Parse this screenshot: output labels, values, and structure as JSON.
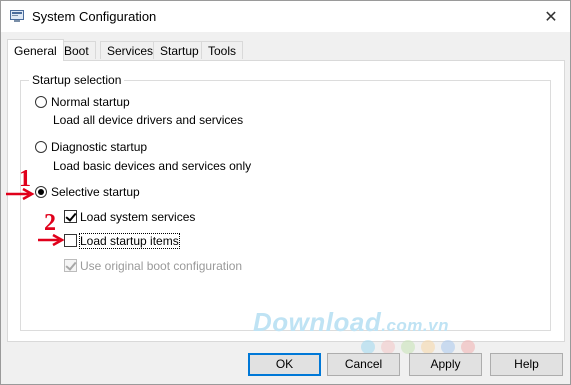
{
  "window": {
    "title": "System Configuration",
    "close_glyph": "✕"
  },
  "tabs": [
    "General",
    "Boot",
    "Services",
    "Startup",
    "Tools"
  ],
  "active_tab": "General",
  "startup_selection": {
    "label": "Startup selection",
    "normal": {
      "label": "Normal startup",
      "description": "Load all device drivers and services",
      "selected": false
    },
    "diagnostic": {
      "label": "Diagnostic startup",
      "description": "Load basic devices and services only",
      "selected": false
    },
    "selective": {
      "label": "Selective startup",
      "selected": true,
      "options": [
        {
          "label": "Load system services",
          "checked": true,
          "enabled": true
        },
        {
          "label": "Load startup items",
          "checked": false,
          "enabled": true
        },
        {
          "label": "Use original boot configuration",
          "checked": true,
          "enabled": false
        }
      ]
    }
  },
  "annotations": {
    "marker_1": "1",
    "marker_2": "2",
    "color": "#e0001b"
  },
  "watermark": {
    "main": "Download",
    "suffix": ".com.vn"
  },
  "buttons": {
    "ok": "OK",
    "cancel": "Cancel",
    "apply": "Apply",
    "help": "Help"
  },
  "icons": {
    "app": "msconfig-icon",
    "close": "close-icon",
    "arrow": "right-arrow-icon"
  }
}
